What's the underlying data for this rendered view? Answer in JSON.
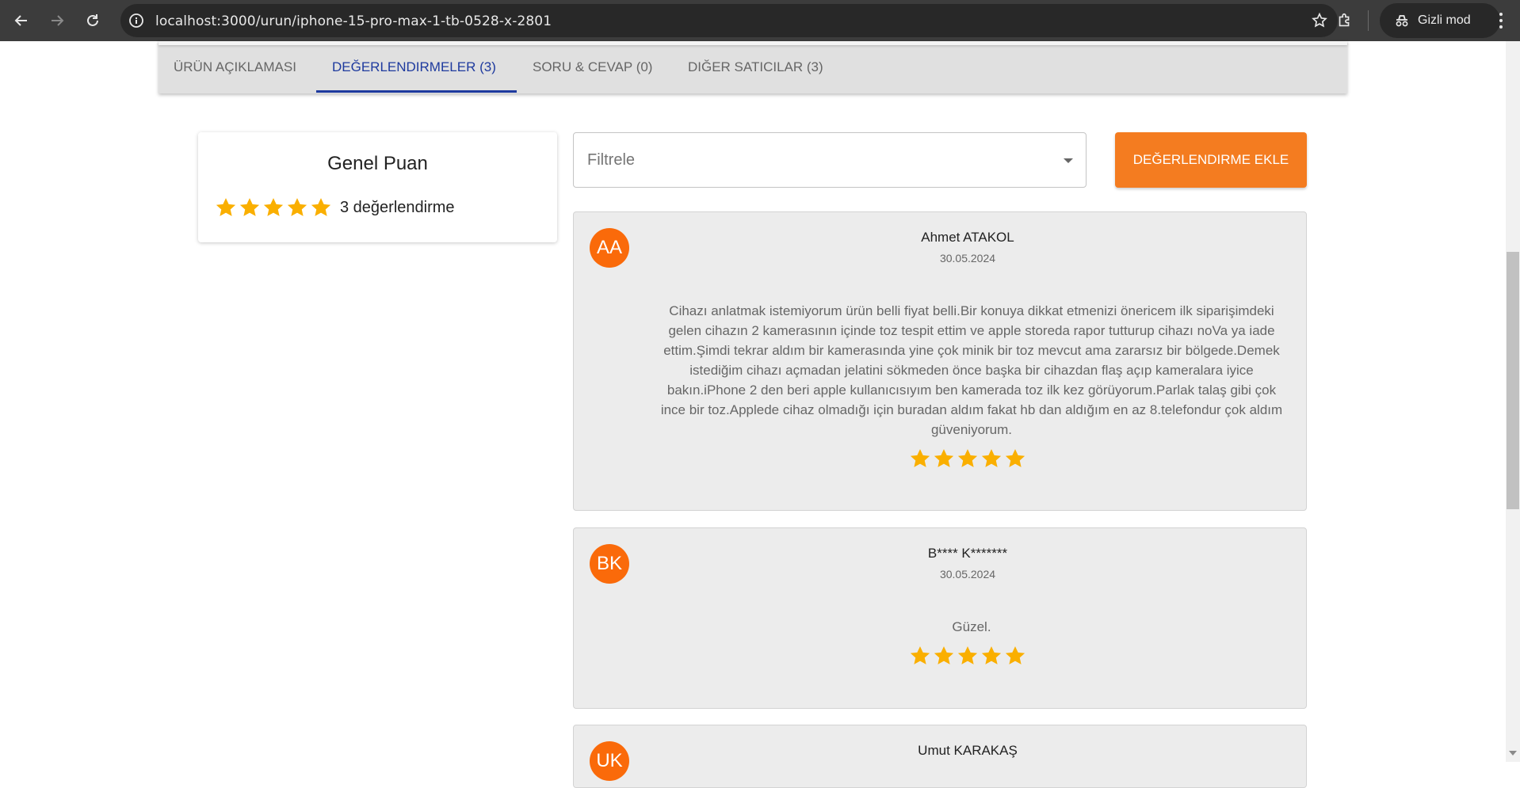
{
  "browser": {
    "url": "localhost:3000/urun/iphone-15-pro-max-1-tb-0528-x-2801",
    "incognito_label": "Gizli mod"
  },
  "tabs": [
    {
      "label": "ÜRÜN AÇIKLAMASI"
    },
    {
      "label": "DEĞERLENDIRMELER (3)",
      "active": true
    },
    {
      "label": "SORU & CEVAP (0)"
    },
    {
      "label": "DIĞER SATICILAR (3)"
    }
  ],
  "score": {
    "title": "Genel Puan",
    "rating": 5,
    "count_label": "3 değerlendirme"
  },
  "filter": {
    "placeholder": "Filtrele"
  },
  "add_review_button": "DEĞERLENDIRME EKLE",
  "reviews": [
    {
      "initials": "AA",
      "name": "Ahmet ATAKOL",
      "date": "30.05.2024",
      "text": "Cihazı anlatmak istemiyorum ürün belli fiyat belli.Bir konuya dikkat etmenizi önericem ilk siparişimdeki gelen cihazın 2 kamerasının içinde toz tespit ettim ve apple storeda rapor tutturup cihazı noVa ya iade ettim.Şimdi tekrar aldım bir kamerasında yine çok minik bir toz mevcut ama zararsız bir bölgede.Demek istediğim cihazı açmadan jelatini sökmeden önce başka bir cihazdan flaş açıp kameralara iyice bakın.iPhone 2 den beri apple kullanıcısıyım ben kamerada toz ilk kez görüyorum.Parlak talaş gibi çok ince bir toz.Applede cihaz olmadığı için buradan aldım fakat hb dan aldığım en az 8.telefondur çok aldım güveniyorum.",
      "rating": 5
    },
    {
      "initials": "BK",
      "name": "B**** K*******",
      "date": "30.05.2024",
      "text": "Güzel.",
      "rating": 5
    },
    {
      "initials": "UK",
      "name": "Umut KARAKAŞ"
    }
  ],
  "colors": {
    "accent_orange": "#f47c20",
    "avatar_orange": "#fa6a0a",
    "star_gold": "#faaf00",
    "tab_active": "#1e3a9e"
  }
}
